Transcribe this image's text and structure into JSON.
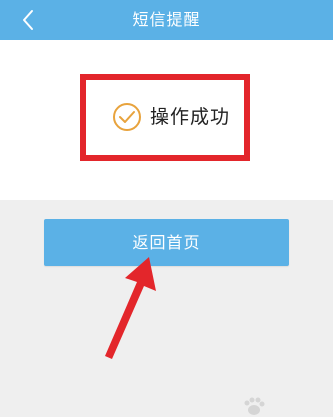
{
  "header": {
    "title": "短信提醒",
    "background": "#5bb1e6",
    "back_icon": "chevron-left-icon"
  },
  "status": {
    "message": "操作成功",
    "icon": "check-circle-icon",
    "icon_color": "#e8a33d",
    "highlight_color": "#e3262b"
  },
  "actions": {
    "home_label": "返回首页"
  },
  "annotation": {
    "arrow_color": "#e3262b",
    "arrow_icon": "red-arrow-pointer"
  }
}
